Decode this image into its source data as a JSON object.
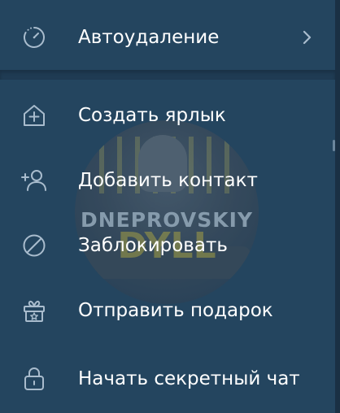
{
  "menu": {
    "items": [
      {
        "label": "Автоудаление",
        "icon": "timer-auto-delete-icon",
        "has_submenu": true
      },
      {
        "label": "Создать ярлык",
        "icon": "home-add-icon"
      },
      {
        "label": "Добавить контакт",
        "icon": "add-user-icon"
      },
      {
        "label": "Заблокировать",
        "icon": "block-icon"
      },
      {
        "label": "Отправить подарок",
        "icon": "gift-icon"
      },
      {
        "label": "Начать секретный чат",
        "icon": "lock-icon"
      }
    ]
  },
  "watermark": {
    "title": "DNEPROVSKIY",
    "subtitle": "DYLL"
  },
  "colors": {
    "background": "#24455f",
    "divider": "#1f3b53",
    "icon": "#a9bccd",
    "text": "#ffffff"
  }
}
